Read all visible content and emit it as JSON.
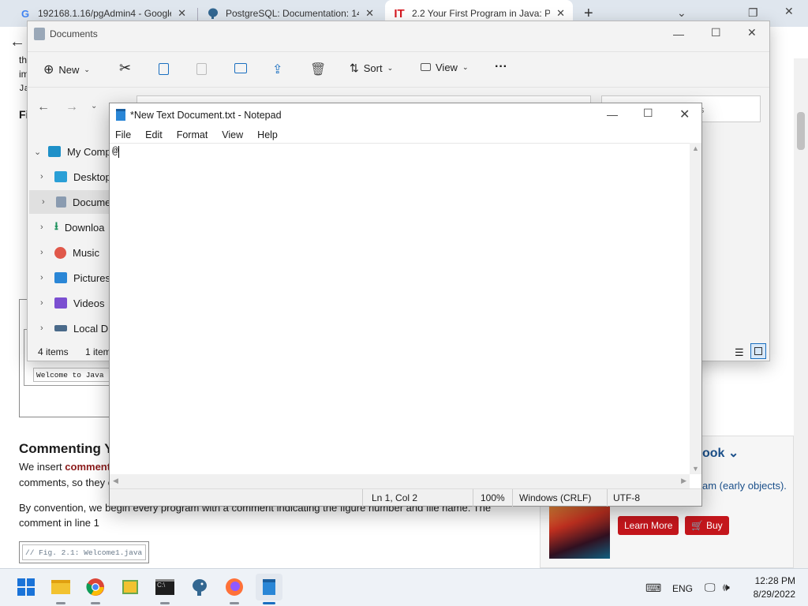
{
  "browser": {
    "tabs": [
      {
        "label": "192168.1.16/pgAdmin4 - Google",
        "favicon": "G",
        "active": false
      },
      {
        "label": "PostgreSQL: Documentation: 14:",
        "favicon": "elephant",
        "active": false
      },
      {
        "label": "2.2 Your First Program in Java: Pr",
        "favicon": "IT",
        "active": true
      }
    ],
    "new_tab": "+",
    "chevron": "⌄",
    "restore": "❐",
    "close": "✕",
    "back": "←"
  },
  "webpage": {
    "frag_th": "th",
    "frag_im": "im",
    "frag_ja": "Ja",
    "frag_fi": "Fi",
    "code1": "Welcome to Java",
    "heading": "Commenting Y",
    "para1_a": "We insert ",
    "para1_b": "comment",
    "para1_c": "comments, so they c",
    "para2_line1": "By convention, we begin every program with a comment indicating the figure number and file name. The",
    "para2_line2": "comment in line 1",
    "code2": "// Fig. 2.1: Welcome1.java",
    "side_heading": "ook",
    "side_link": "am (early objects).",
    "learn_more": "Learn More",
    "buy": "Buy"
  },
  "explorer": {
    "title": "Documents",
    "toolbar": {
      "new": "New",
      "sort": "Sort",
      "view": "View",
      "more": "···"
    },
    "search_placeholder": "ts",
    "tree": [
      {
        "label": "My Comp",
        "icon": "computer-icon",
        "color": "#1e90c8"
      },
      {
        "label": "Desktop",
        "icon": "desktop-icon",
        "color": "#2a9fd6"
      },
      {
        "label": "Docume",
        "icon": "documents-icon",
        "color": "#8a9bb0"
      },
      {
        "label": "Downloa",
        "icon": "download-icon",
        "color": "#1a8f5a"
      },
      {
        "label": "Music",
        "icon": "music-icon",
        "color": "#e0584a"
      },
      {
        "label": "Pictures",
        "icon": "pictures-icon",
        "color": "#2a86d6"
      },
      {
        "label": "Videos",
        "icon": "videos-icon",
        "color": "#7b4fd1"
      },
      {
        "label": "Local Dis",
        "icon": "drive-icon",
        "color": "#4a6a8a"
      }
    ],
    "status_items": "4 items",
    "status_selected": "1 item"
  },
  "notepad": {
    "title": "*New Text Document.txt - Notepad",
    "menu": [
      "File",
      "Edit",
      "Format",
      "View",
      "Help"
    ],
    "content": "@",
    "status": {
      "position": "Ln 1, Col 2",
      "zoom": "100%",
      "line_ending": "Windows (CRLF)",
      "encoding": "UTF-8"
    }
  },
  "taskbar": {
    "lang": "ENG",
    "time": "12:28 PM",
    "date": "8/29/2022"
  }
}
